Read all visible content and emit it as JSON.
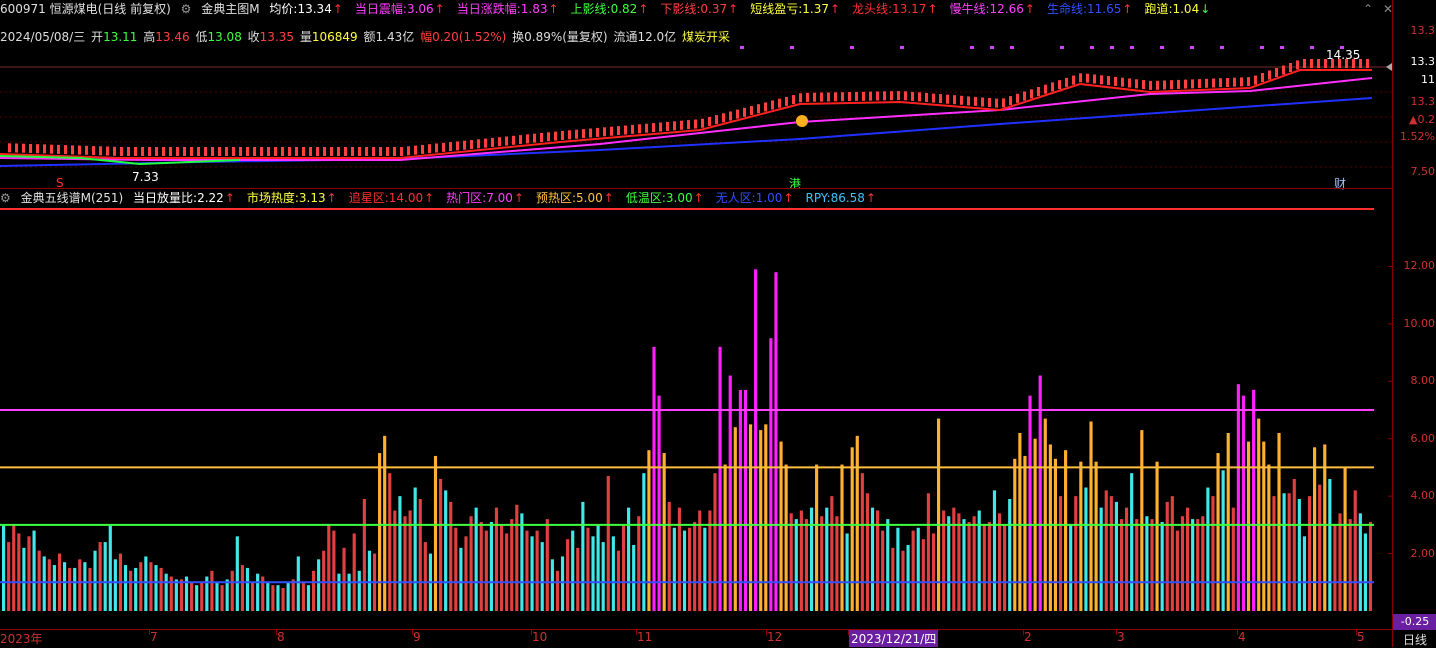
{
  "header": {
    "code_name": "600971 恒源煤电(日线 前复权)",
    "indicator": "金典主图M",
    "fields": [
      {
        "label": "均价:",
        "value": "13.34",
        "color": "#ffffff",
        "arrow": "up"
      },
      {
        "label": "当日震幅:",
        "value": "3.06",
        "color": "#ff40ff",
        "arrow": "up"
      },
      {
        "label": "当日涨跌幅:",
        "value": "1.83",
        "color": "#ff40ff",
        "arrow": "up"
      },
      {
        "label": "上影线:",
        "value": "0.82",
        "color": "#40ff40",
        "arrow": "up"
      },
      {
        "label": "下影线:",
        "value": "0.37",
        "color": "#ff4040",
        "arrow": "up"
      },
      {
        "label": "短线盈亏:",
        "value": "1.37",
        "color": "#ffff40",
        "arrow": "up"
      },
      {
        "label": "龙头线:",
        "value": "13.17",
        "color": "#ff3030",
        "arrow": "up"
      },
      {
        "label": "慢牛线:",
        "value": "12.66",
        "color": "#ff40ff",
        "arrow": "up"
      },
      {
        "label": "生命线:",
        "value": "11.65",
        "color": "#3050ff",
        "arrow": "up"
      },
      {
        "label": "跑道:",
        "value": "1.04",
        "color": "#ffff40",
        "arrow": "down"
      }
    ]
  },
  "quote": {
    "date": "2024/05/08/三",
    "open_label": "开",
    "open": "13.11",
    "high_label": "高",
    "high": "13.46",
    "low_label": "低",
    "low": "13.08",
    "close_label": "收",
    "close": "13.35",
    "vol_label": "量",
    "vol": "106849",
    "amt": "额1.43亿",
    "change": "幅0.20(1.52%)",
    "turnover": "换0.89%(量复权)",
    "float": "流通12.0亿",
    "sector": "煤炭开采"
  },
  "top_chart": {
    "price_high_label": "14.35",
    "price_low_label": "7.33",
    "markers": {
      "s": "S",
      "gang": "港",
      "cai": "财"
    },
    "y_labels": [
      "13.3",
      "13.3",
      "11",
      "13.3",
      "▲0.2",
      "1.52%",
      "7.50"
    ]
  },
  "bottom_header": {
    "indicator": "金典五线谱M(251)",
    "fields": [
      {
        "label": "当日放量比:",
        "value": "2.22",
        "color": "#ffffff",
        "arrow": "up"
      },
      {
        "label": "市场热度:",
        "value": "3.13",
        "color": "#ffff40",
        "arrow": "up"
      },
      {
        "label": "追星区:",
        "value": "14.00",
        "color": "#ff3030",
        "arrow": "up"
      },
      {
        "label": "热门区:",
        "value": "7.00",
        "color": "#ff40ff",
        "arrow": "up"
      },
      {
        "label": "预热区:",
        "value": "5.00",
        "color": "#ffc040",
        "arrow": "up"
      },
      {
        "label": "低温区:",
        "value": "3.00",
        "color": "#40ff40",
        "arrow": "up"
      },
      {
        "label": "无人区:",
        "value": "1.00",
        "color": "#3050ff",
        "arrow": "up"
      },
      {
        "label": "RPY:",
        "value": "86.58",
        "color": "#40c0ff",
        "arrow": "up"
      }
    ]
  },
  "bottom_axis": {
    "labels": [
      "12.00",
      "10.00",
      "8.00",
      "6.00",
      "4.00",
      "2.00"
    ],
    "readout": "-0.25",
    "period": "日线"
  },
  "x_axis": {
    "labels": [
      {
        "text": "2023年",
        "x": 0
      },
      {
        "text": "7",
        "x": 150
      },
      {
        "text": "8",
        "x": 277
      },
      {
        "text": "9",
        "x": 413
      },
      {
        "text": "10",
        "x": 532
      },
      {
        "text": "11",
        "x": 637
      },
      {
        "text": "12",
        "x": 767
      },
      {
        "text": "2023/12/21/四",
        "x": 849,
        "hl": true
      },
      {
        "text": "2",
        "x": 1024
      },
      {
        "text": "3",
        "x": 1117
      },
      {
        "text": "4",
        "x": 1238
      },
      {
        "text": "5",
        "x": 1357
      }
    ]
  },
  "chart_data": {
    "type": "bar",
    "title": "金典五线谱M(251)",
    "ylim": [
      0,
      14
    ],
    "reference_lines": [
      {
        "name": "追星区",
        "value": 14.0,
        "color": "#ff3030"
      },
      {
        "name": "热门区",
        "value": 7.0,
        "color": "#ff40ff"
      },
      {
        "name": "预热区",
        "value": 5.0,
        "color": "#ffc040"
      },
      {
        "name": "低温区",
        "value": 3.0,
        "color": "#40ff40"
      },
      {
        "name": "无人区",
        "value": 1.0,
        "color": "#3050ff"
      }
    ],
    "values": [
      3.0,
      2.4,
      3.0,
      2.7,
      2.2,
      2.6,
      2.8,
      2.1,
      1.9,
      1.8,
      1.6,
      2.0,
      1.7,
      1.5,
      1.5,
      1.8,
      1.7,
      1.5,
      2.1,
      2.4,
      2.4,
      3.0,
      1.8,
      2.0,
      1.6,
      1.4,
      1.5,
      1.7,
      1.9,
      1.7,
      1.6,
      1.5,
      1.3,
      1.2,
      1.1,
      1.1,
      1.2,
      1.0,
      0.9,
      1.0,
      1.2,
      1.4,
      1.0,
      0.9,
      1.1,
      1.4,
      2.6,
      1.6,
      1.5,
      1.0,
      1.3,
      1.2,
      1.0,
      0.9,
      0.9,
      0.8,
      1.0,
      1.1,
      1.9,
      1.0,
      0.9,
      1.4,
      1.8,
      2.1,
      3.0,
      2.8,
      1.3,
      2.2,
      1.3,
      2.7,
      1.4,
      3.9,
      2.1,
      2.0,
      5.5,
      6.1,
      4.8,
      3.5,
      4.0,
      3.3,
      3.5,
      4.3,
      3.9,
      2.4,
      2.0,
      5.4,
      4.6,
      4.2,
      3.8,
      2.9,
      2.2,
      2.6,
      3.3,
      3.6,
      3.1,
      2.8,
      3.1,
      3.6,
      3.0,
      2.7,
      3.2,
      3.7,
      3.4,
      2.8,
      2.6,
      2.8,
      2.4,
      3.2,
      1.8,
      1.4,
      1.9,
      2.5,
      2.8,
      2.2,
      3.8,
      2.9,
      2.6,
      3.0,
      2.4,
      4.7,
      2.6,
      2.1,
      3.0,
      3.6,
      2.3,
      3.3,
      4.8,
      5.6,
      9.2,
      7.5,
      5.5,
      3.8,
      2.9,
      3.6,
      2.8,
      2.9,
      3.1,
      3.5,
      2.9,
      3.5,
      4.8,
      9.2,
      5.1,
      8.2,
      6.4,
      7.7,
      7.7,
      6.5,
      11.9,
      6.3,
      6.5,
      9.5,
      11.8,
      5.9,
      5.1,
      3.4,
      3.2,
      3.5,
      3.2,
      3.6,
      5.1,
      3.3,
      3.6,
      4.0,
      3.3,
      5.1,
      2.7,
      5.7,
      6.1,
      4.8,
      4.1,
      3.6,
      3.5,
      2.8,
      3.2,
      2.2,
      2.9,
      2.1,
      2.3,
      2.8,
      2.9,
      2.5,
      4.1,
      2.7,
      6.7,
      3.5,
      3.3,
      3.6,
      3.4,
      3.2,
      3.1,
      3.3,
      3.5,
      3.0,
      3.1,
      4.2,
      3.4,
      3.0,
      3.9,
      5.3,
      6.2,
      5.4,
      7.5,
      6.0,
      8.2,
      6.7,
      5.8,
      5.3,
      4.0,
      5.6,
      3.0,
      4.0,
      5.2,
      4.3,
      6.6,
      5.2,
      3.6,
      4.2,
      4.0,
      3.8,
      3.2,
      3.6,
      4.8,
      3.2,
      6.3,
      3.3,
      3.2,
      5.2,
      3.1,
      3.8,
      4.0,
      2.8,
      3.3,
      3.6,
      3.2,
      3.2,
      3.3,
      4.3,
      4.0,
      5.5,
      4.9,
      6.2,
      3.6,
      7.9,
      7.5,
      5.9,
      7.7,
      6.7,
      5.9,
      5.1,
      4.0,
      6.2,
      4.1,
      4.1,
      4.6,
      3.9,
      2.6,
      4.0,
      5.7,
      4.4,
      5.8,
      4.6,
      3.0,
      3.4,
      5.0,
      3.2,
      4.2,
      3.4,
      2.7,
      3.1
    ]
  }
}
